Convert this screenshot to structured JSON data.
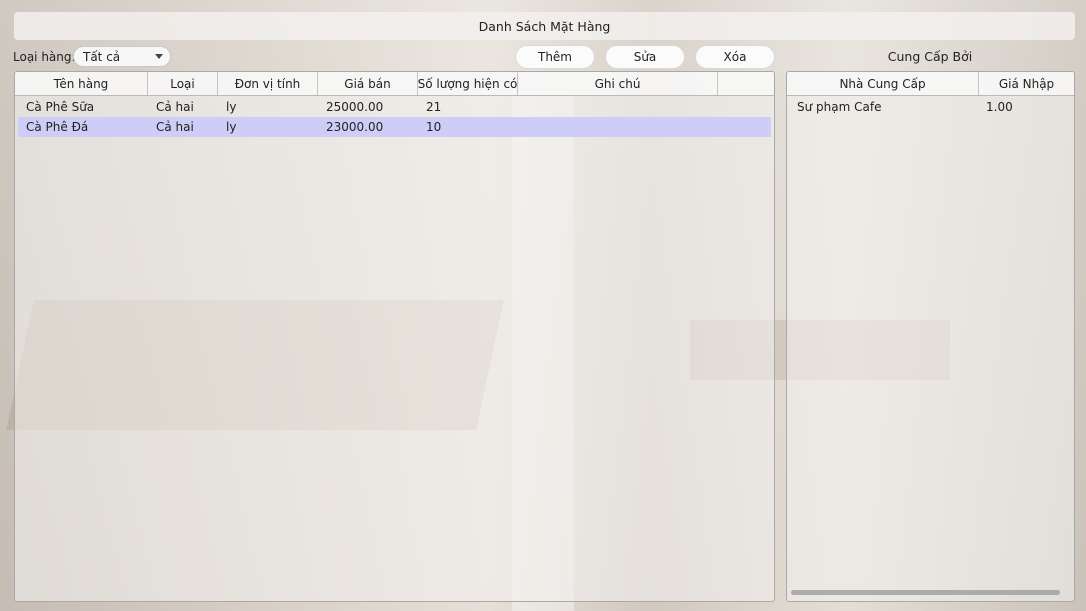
{
  "header": {
    "title": "Danh Sách Mặt Hàng"
  },
  "filter": {
    "label": "Loại hàng:",
    "selected": "Tất cả"
  },
  "toolbar": {
    "add_label": "Thêm",
    "edit_label": "Sửa",
    "delete_label": "Xóa"
  },
  "items_table": {
    "columns": [
      "Tên hàng",
      "Loại",
      "Đơn vị tính",
      "Giá bán",
      "Số lượng hiện có",
      "Ghi chú",
      ""
    ],
    "rows": [
      {
        "name": "Cà Phê Sữa",
        "type": "Cả hai",
        "unit": "ly",
        "price": "25000.00",
        "qty": "21",
        "note": ""
      },
      {
        "name": "Cà Phê Đá",
        "type": "Cả hai",
        "unit": "ly",
        "price": "23000.00",
        "qty": "10",
        "note": ""
      }
    ],
    "selected_row": 1
  },
  "supplier_panel": {
    "title": "Cung Cấp Bởi",
    "columns": [
      "Nhà Cung Cấp",
      "Giá Nhập"
    ],
    "rows": [
      {
        "supplier": "Sư phạm Cafe",
        "price": "1.00"
      }
    ]
  },
  "colors": {
    "selection": "#cdcdf7",
    "border": "#a9a9a9"
  }
}
